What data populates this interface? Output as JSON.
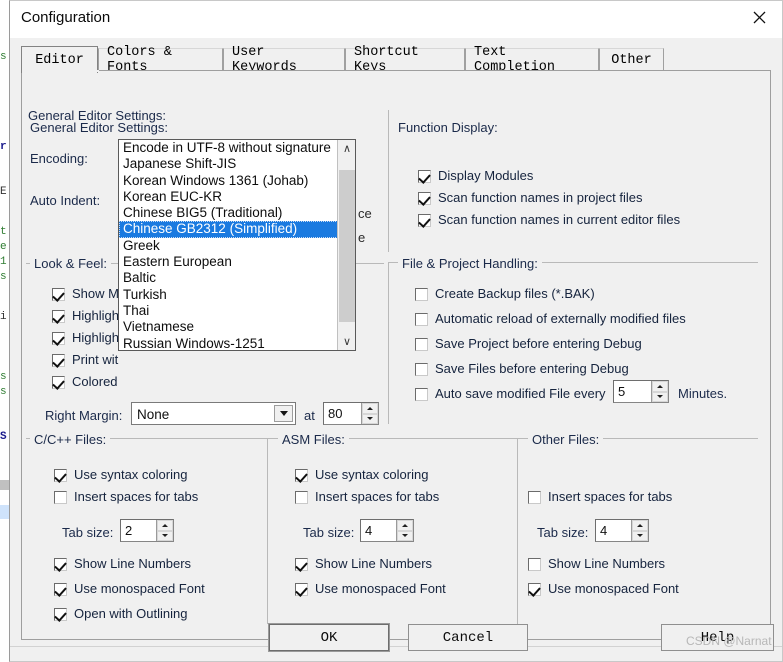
{
  "window": {
    "title": "Configuration",
    "close_icon": "close-icon"
  },
  "tabs": [
    {
      "label": "Editor",
      "active": true
    },
    {
      "label": "Colors & Fonts",
      "active": false
    },
    {
      "label": "User Keywords",
      "active": false
    },
    {
      "label": "Shortcut Keys",
      "active": false
    },
    {
      "label": "Text Completion",
      "active": false
    },
    {
      "label": "Other",
      "active": false
    }
  ],
  "general_editor": {
    "title": "General Editor Settings:",
    "encoding_label": "Encoding:",
    "encoding_value": "Chinese GB2312 (Simplified)",
    "auto_indent_label": "Auto Indent:",
    "occluded_fragment_1": "ce",
    "occluded_fragment_2": "e"
  },
  "encoding_dropdown": {
    "open": true,
    "selected": "Chinese GB2312 (Simplified)",
    "items": [
      "Encode in UTF-8 without signature",
      "Japanese Shift-JIS",
      "Korean Windows 1361 (Johab)",
      "Korean EUC-KR",
      "Chinese BIG5 (Traditional)",
      "Chinese GB2312 (Simplified)",
      "Greek",
      "Eastern European",
      "Baltic",
      "Turkish",
      "Thai",
      "Vietnamese",
      "Russian Windows-1251"
    ],
    "scroll_up_glyph": "∧",
    "scroll_down_glyph": "∨"
  },
  "look_feel": {
    "title": "Look & Feel:",
    "items": [
      {
        "label": "Show M",
        "checked": true
      },
      {
        "label": "Highligh",
        "checked": true
      },
      {
        "label": "Highligh",
        "checked": true
      },
      {
        "label": "Print wit",
        "checked": true
      },
      {
        "label": "Colored",
        "checked": true
      }
    ],
    "right_margin_label": "Right Margin:",
    "right_margin_value": "None",
    "at_label": "at",
    "at_value": "80"
  },
  "function_display": {
    "title": "Function Display:",
    "items": [
      {
        "label": "Display Modules",
        "checked": true
      },
      {
        "label": "Scan function names in project files",
        "checked": true
      },
      {
        "label": "Scan function names in current editor files",
        "checked": true
      }
    ]
  },
  "file_project": {
    "title": "File & Project Handling:",
    "items": [
      {
        "label": "Create Backup files (*.BAK)",
        "checked": false
      },
      {
        "label": "Automatic reload of externally modified files",
        "checked": false
      },
      {
        "label": "Save Project before entering Debug",
        "checked": false
      },
      {
        "label": "Save Files before entering Debug",
        "checked": false
      }
    ],
    "autosave": {
      "label": "Auto save modified File every",
      "checked": false,
      "value": "5",
      "suffix": "Minutes."
    }
  },
  "c_files": {
    "title": "C/C++ Files:",
    "syntax_coloring": {
      "label": "Use syntax coloring",
      "checked": true
    },
    "insert_spaces": {
      "label": "Insert spaces for tabs",
      "checked": false
    },
    "tab_size_label": "Tab size:",
    "tab_size_value": "2",
    "show_line_numbers": {
      "label": "Show Line Numbers",
      "checked": true
    },
    "monospaced": {
      "label": "Use monospaced Font",
      "checked": true
    },
    "outlining": {
      "label": "Open with Outlining",
      "checked": true
    }
  },
  "asm_files": {
    "title": "ASM Files:",
    "syntax_coloring": {
      "label": "Use syntax coloring",
      "checked": true
    },
    "insert_spaces": {
      "label": "Insert spaces for tabs",
      "checked": false
    },
    "tab_size_label": "Tab size:",
    "tab_size_value": "4",
    "show_line_numbers": {
      "label": "Show Line Numbers",
      "checked": true
    },
    "monospaced": {
      "label": "Use monospaced Font",
      "checked": true
    }
  },
  "other_files": {
    "title": "Other Files:",
    "insert_spaces": {
      "label": "Insert spaces for tabs",
      "checked": false
    },
    "tab_size_label": "Tab size:",
    "tab_size_value": "4",
    "show_line_numbers": {
      "label": "Show Line Numbers",
      "checked": false
    },
    "monospaced": {
      "label": "Use monospaced Font",
      "checked": true
    }
  },
  "buttons": {
    "ok": "OK",
    "cancel": "Cancel",
    "help": "Help"
  },
  "watermark": "CSDN @Narnat",
  "colors": {
    "dialog_bg": "#f0f0f0",
    "selection_blue": "#1a7ae0",
    "label_text": "#1b2a4a",
    "frame_line": "#b9b9b9"
  }
}
